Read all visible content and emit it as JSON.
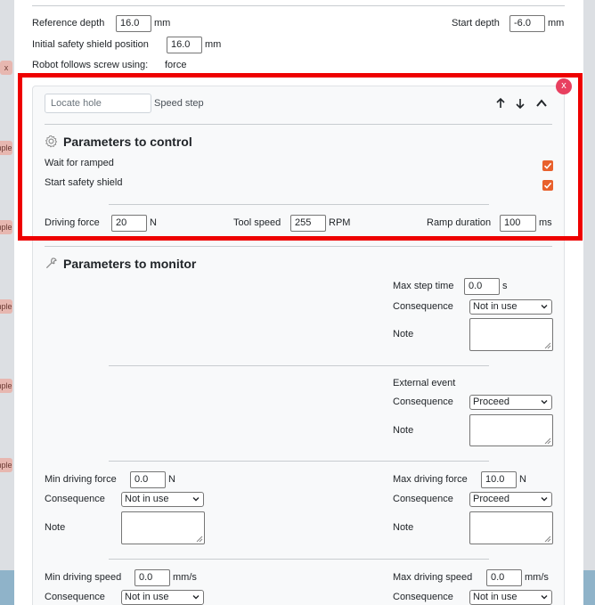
{
  "background": {
    "tags": [
      "x",
      "mple",
      "mple",
      "mple",
      "mple",
      "mple"
    ]
  },
  "settings": {
    "reference_depth_label": "Reference depth",
    "reference_depth_value": "16.0",
    "reference_depth_unit": "mm",
    "start_depth_label": "Start depth",
    "start_depth_value": "-6.0",
    "start_depth_unit": "mm",
    "shield_position_label": "Initial safety shield position",
    "shield_position_value": "16.0",
    "shield_position_unit": "mm",
    "robot_follows_label": "Robot follows screw using:",
    "robot_follows_value": "force"
  },
  "step": {
    "name_placeholder": "Locate hole",
    "type_label": "Speed step",
    "close_label": "x",
    "control": {
      "title": "Parameters to control",
      "wait_for_ramped_label": "Wait for ramped",
      "wait_for_ramped_checked": true,
      "start_safety_shield_label": "Start safety shield",
      "start_safety_shield_checked": true,
      "driving_force_label": "Driving force",
      "driving_force_value": "20",
      "driving_force_unit": "N",
      "tool_speed_label": "Tool speed",
      "tool_speed_value": "255",
      "tool_speed_unit": "RPM",
      "ramp_duration_label": "Ramp duration",
      "ramp_duration_value": "100",
      "ramp_duration_unit": "ms"
    },
    "monitor": {
      "title": "Parameters to monitor",
      "max_step_time_label": "Max step time",
      "max_step_time_value": "0.0",
      "max_step_time_unit": "s",
      "consequence_label": "Consequence",
      "note_label": "Note",
      "max_step_time_consequence": "Not in use",
      "external_event_label": "External event",
      "external_event_consequence": "Proceed",
      "min_driving_force_label": "Min driving force",
      "min_driving_force_value": "0.0",
      "min_driving_force_unit": "N",
      "min_driving_force_consequence": "Not in use",
      "max_driving_force_label": "Max driving force",
      "max_driving_force_value": "10.0",
      "max_driving_force_unit": "N",
      "max_driving_force_consequence": "Proceed",
      "min_driving_speed_label": "Min driving speed",
      "min_driving_speed_value": "0.0",
      "min_driving_speed_unit": "mm/s",
      "min_driving_speed_consequence": "Not in use",
      "max_driving_speed_label": "Max driving speed",
      "max_driving_speed_value": "0.0",
      "max_driving_speed_unit": "mm/s",
      "max_driving_speed_consequence": "Not in use"
    }
  },
  "colors": {
    "highlight": "#ee0000",
    "checkbox": "#e8602c",
    "close": "#e84060"
  }
}
